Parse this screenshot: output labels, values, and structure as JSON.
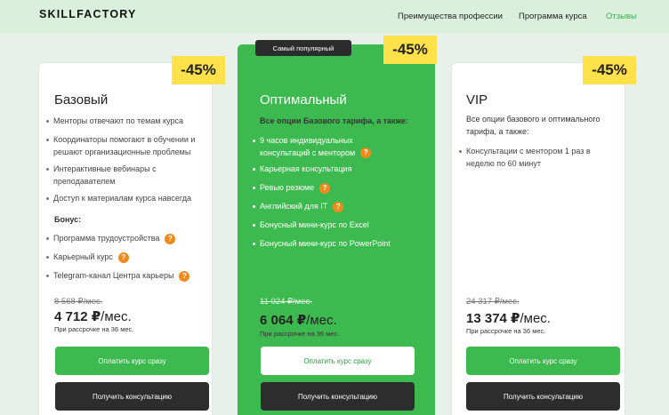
{
  "header": {
    "logo": "SKILLFACTORY",
    "nav": [
      "Преимущества профессии",
      "Программа курса",
      "Отзывы"
    ]
  },
  "colors": {
    "accent": "#3dba4f",
    "discount_badge": "#ffe24a",
    "tooltip_icon": "#f08a1d",
    "dark_button": "#2d2d2d"
  },
  "plans": [
    {
      "discount": "-45%",
      "title": "Базовый",
      "features": [
        "Менторы отвечают по темам курса",
        "Координаторы помогают в обучении и решают организационные проблемы",
        "Интерактивные вебинары с преподавателем",
        "Доступ к материалам курса навсегда"
      ],
      "bonus_title": "Бонус:",
      "bonus": [
        "Программа трудоустройства",
        "Карьерный курс",
        "Telegram-канал Центра карьеры"
      ],
      "old_price": "8 568 ₽/мес.",
      "price": "4 712 ₽",
      "price_unit": "/мес.",
      "installment": "При рассрочке на 36 мес.",
      "pay_label": "Оплатить курс сразу",
      "consult_label": "Получить консультацию"
    },
    {
      "badge": "Самый популярный",
      "discount": "-45%",
      "title": "Оптимальный",
      "intro": "Все опции Базового тарифа, а также:",
      "features": [
        "9 часов индивидуальных консультаций с ментором",
        "Карьерная консультация",
        "Ревью резюме",
        "Английский для IT",
        "Бонусный мини-курс по Excel",
        "Бонусный мини-курс по PowerPoint"
      ],
      "old_price": "11 024 ₽/мес.",
      "price": "6 064 ₽",
      "price_unit": "/мес.",
      "installment": "При рассрочке на 36 мес.",
      "pay_label": "Оплатить курс сразу",
      "consult_label": "Получить консультацию"
    },
    {
      "discount": "-45%",
      "title": "VIP",
      "intro": "Все опции базового и оптимального тарифа, а также:",
      "features": [
        "Консультации с ментором 1 раз в неделю по 60 минут"
      ],
      "old_price": "24 317 ₽/мес.",
      "price": "13 374 ₽",
      "price_unit": "/мес.",
      "installment": "При рассрочке на 36 мес.",
      "pay_label": "Оплатить курс сразу",
      "consult_label": "Получить консультацию"
    }
  ],
  "tooltip_glyph": "?"
}
